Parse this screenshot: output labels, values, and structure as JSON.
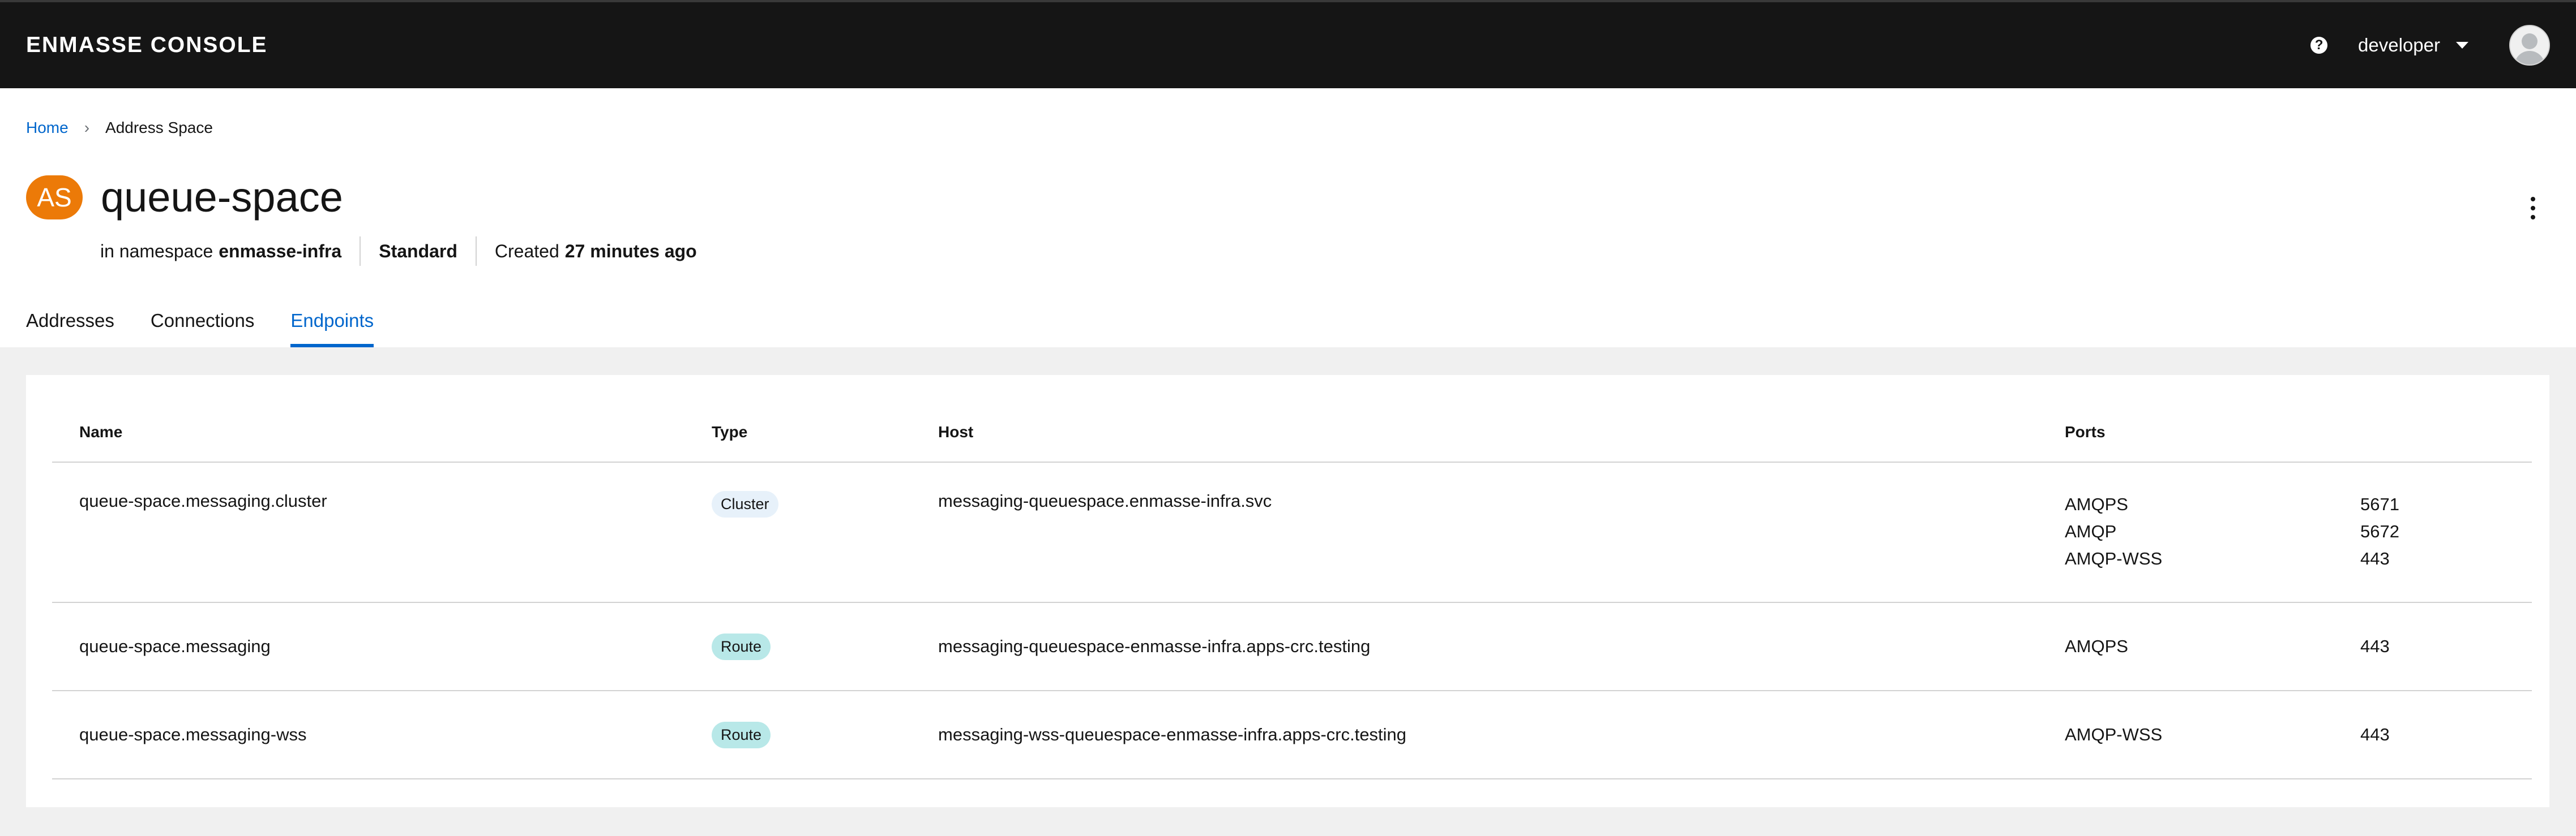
{
  "masthead": {
    "brand": "ENMASSE CONSOLE",
    "help_icon": "question-circle-icon",
    "user": "developer",
    "avatar_icon": "user-avatar-icon"
  },
  "breadcrumb": {
    "home": "Home",
    "separator": "›",
    "current": "Address Space"
  },
  "header": {
    "badge": "AS",
    "title": "queue-space",
    "namespace_prefix": "in namespace",
    "namespace": "enmasse-infra",
    "type": "Standard",
    "created_prefix": "Created",
    "created_value": "27 minutes ago"
  },
  "tabs": [
    {
      "label": "Addresses",
      "active": false
    },
    {
      "label": "Connections",
      "active": false
    },
    {
      "label": "Endpoints",
      "active": true
    }
  ],
  "table": {
    "columns": [
      "Name",
      "Type",
      "Host",
      "Ports"
    ],
    "rows": [
      {
        "name": "queue-space.messaging.cluster",
        "type": "Cluster",
        "host": "messaging-queuespace.enmasse-infra.svc",
        "ports": [
          {
            "protocol": "AMQPS",
            "port": "5671"
          },
          {
            "protocol": "AMQP",
            "port": "5672"
          },
          {
            "protocol": "AMQP-WSS",
            "port": "443"
          }
        ]
      },
      {
        "name": "queue-space.messaging",
        "type": "Route",
        "host": "messaging-queuespace-enmasse-infra.apps-crc.testing",
        "ports": [
          {
            "protocol": "AMQPS",
            "port": "443"
          }
        ]
      },
      {
        "name": "queue-space.messaging-wss",
        "type": "Route",
        "host": "messaging-wss-queuespace-enmasse-infra.apps-crc.testing",
        "ports": [
          {
            "protocol": "AMQP-WSS",
            "port": "443"
          }
        ]
      }
    ]
  },
  "colors": {
    "masthead": "#151515",
    "accent": "#0066cc",
    "badge": "#ec7a08",
    "cluster_pill": "#e7f1fa",
    "route_pill": "#b8e8e8",
    "content_bg": "#f0f0f0"
  }
}
